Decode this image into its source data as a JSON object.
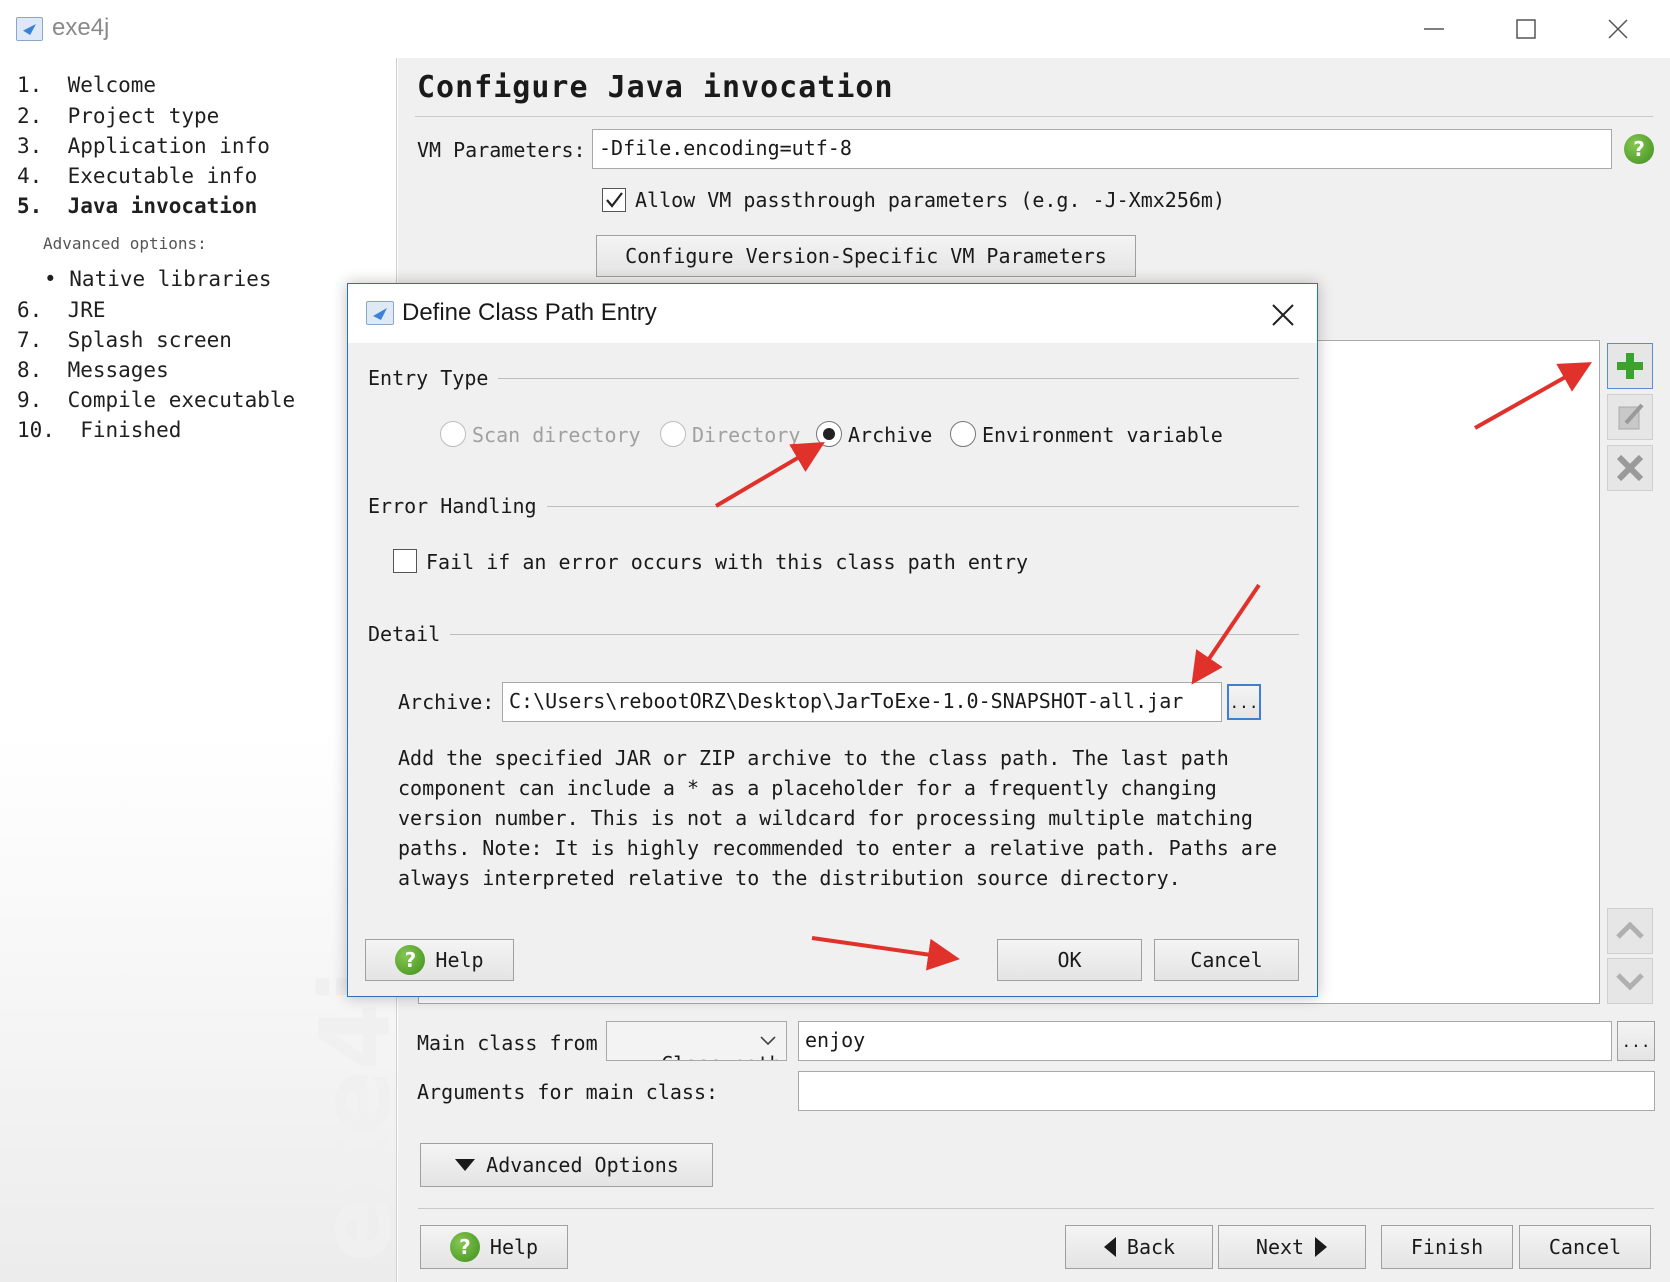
{
  "window": {
    "title": "exe4j"
  },
  "nav": {
    "items": [
      {
        "label": "1.  Welcome"
      },
      {
        "label": "2.  Project type"
      },
      {
        "label": "3.  Application info"
      },
      {
        "label": "4.  Executable info"
      },
      {
        "label": "5.  Java invocation"
      },
      {
        "label": "Advanced options:"
      },
      {
        "label": "• Native libraries"
      },
      {
        "label": "6.  JRE"
      },
      {
        "label": "7.  Splash screen"
      },
      {
        "label": "8.  Messages"
      },
      {
        "label": "9.  Compile executable"
      },
      {
        "label": "10.  Finished"
      }
    ],
    "watermark": "exe4j"
  },
  "main": {
    "heading": "Configure Java invocation",
    "vm_params_label": "VM Parameters:",
    "vm_params_value": "-Dfile.encoding=utf-8",
    "allow_passthrough_label": "Allow VM passthrough parameters (e.g. -J-Xmx256m)",
    "allow_passthrough_checked": true,
    "configure_version_button": "Configure Version-Specific VM Parameters",
    "main_class_from_label": "Main class from",
    "main_class_source": "Class path",
    "main_class_value": "enjoy",
    "browse_button": "...",
    "arguments_label": "Arguments for main class:",
    "arguments_value": "",
    "advanced_options_button": "Advanced Options",
    "help_button": "Help",
    "back_button": "Back",
    "next_button": "Next",
    "finish_button": "Finish",
    "cancel_button": "Cancel"
  },
  "dialog": {
    "title": "Define Class Path Entry",
    "entry_type_heading": "Entry Type",
    "entry_types": [
      {
        "label": "Scan directory",
        "enabled": false,
        "selected": false
      },
      {
        "label": "Directory",
        "enabled": false,
        "selected": false
      },
      {
        "label": "Archive",
        "enabled": true,
        "selected": true
      },
      {
        "label": "Environment variable",
        "enabled": true,
        "selected": false
      }
    ],
    "error_handling_heading": "Error Handling",
    "fail_checkbox_label": "Fail if an error occurs with this class path entry",
    "fail_checked": false,
    "detail_heading": "Detail",
    "archive_label": "Archive:",
    "archive_value": "C:\\Users\\rebootORZ\\Desktop\\JarToExe-1.0-SNAPSHOT-all.jar",
    "browse_button": "...",
    "description": "Add the specified JAR or ZIP archive to the class path. The last path component can include a * as a placeholder for a frequently changing version number. This is not a wildcard for processing multiple matching paths. Note: It is highly recommended to enter a relative path. Paths are always interpreted relative to the distribution source directory.",
    "help_button": "Help",
    "ok_button": "OK",
    "cancel_button": "Cancel"
  },
  "colors": {
    "accent_border": "#2f6fb5",
    "annotation_arrow": "#e0312a",
    "help_icon": "#4f9e26"
  }
}
